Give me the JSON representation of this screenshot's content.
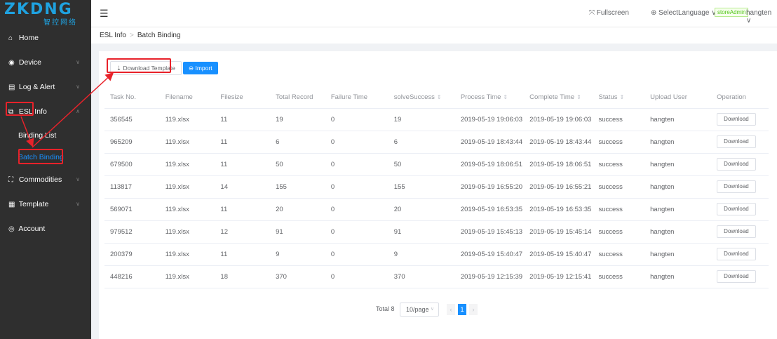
{
  "logo": {
    "main": "ZKDNG",
    "sub": "智控网络"
  },
  "sidebar": {
    "items": [
      {
        "label": "Home",
        "icon": "home-icon",
        "glyph": "⌂"
      },
      {
        "label": "Device",
        "icon": "device-icon",
        "glyph": "◉"
      },
      {
        "label": "Log & Alert",
        "icon": "log-icon",
        "glyph": "▤"
      },
      {
        "label": "ESL Info",
        "icon": "tag-icon",
        "glyph": "⧉"
      },
      {
        "label": "Commodities",
        "icon": "commodities-icon",
        "glyph": "⛶"
      },
      {
        "label": "Template",
        "icon": "template-icon",
        "glyph": "▦"
      },
      {
        "label": "Account",
        "icon": "account-icon",
        "glyph": "◎"
      }
    ],
    "sub_items": [
      {
        "label": "Binding List"
      },
      {
        "label": "Batch Binding"
      }
    ]
  },
  "header": {
    "menu_glyph": "☰",
    "fullscreen": "⤧ Fullscreen",
    "language": "⊕ SelectLanguage ∨",
    "badge": "storeAdmin",
    "user": "hangten ∨"
  },
  "breadcrumb": {
    "first": "ESL Info",
    "sep": ">",
    "current": "Batch Binding"
  },
  "toolbar": {
    "download_template": "⇣ Download Template",
    "import": "⊖ Import"
  },
  "table": {
    "columns": [
      "Task No.",
      "Filename",
      "Filesize",
      "Total Record",
      "Failure Time",
      "solveSuccess",
      "Process Time",
      "Complete Time",
      "Status",
      "Upload User",
      "Operation"
    ],
    "sortable": [
      false,
      false,
      false,
      false,
      false,
      true,
      true,
      true,
      true,
      false,
      false
    ],
    "rows": [
      [
        "356545",
        "119.xlsx",
        "11",
        "19",
        "0",
        "19",
        "2019-05-19 19:06:03",
        "2019-05-19 19:06:03",
        "success",
        "hangten"
      ],
      [
        "965209",
        "119.xlsx",
        "11",
        "6",
        "0",
        "6",
        "2019-05-19 18:43:44",
        "2019-05-19 18:43:44",
        "success",
        "hangten"
      ],
      [
        "679500",
        "119.xlsx",
        "11",
        "50",
        "0",
        "50",
        "2019-05-19 18:06:51",
        "2019-05-19 18:06:51",
        "success",
        "hangten"
      ],
      [
        "113817",
        "119.xlsx",
        "14",
        "155",
        "0",
        "155",
        "2019-05-19 16:55:20",
        "2019-05-19 16:55:21",
        "success",
        "hangten"
      ],
      [
        "569071",
        "119.xlsx",
        "11",
        "20",
        "0",
        "20",
        "2019-05-19 16:53:35",
        "2019-05-19 16:53:35",
        "success",
        "hangten"
      ],
      [
        "979512",
        "119.xlsx",
        "12",
        "91",
        "0",
        "91",
        "2019-05-19 15:45:13",
        "2019-05-19 15:45:14",
        "success",
        "hangten"
      ],
      [
        "200379",
        "119.xlsx",
        "11",
        "9",
        "0",
        "9",
        "2019-05-19 15:40:47",
        "2019-05-19 15:40:47",
        "success",
        "hangten"
      ],
      [
        "448216",
        "119.xlsx",
        "18",
        "370",
        "0",
        "370",
        "2019-05-19 12:15:39",
        "2019-05-19 12:15:41",
        "success",
        "hangten"
      ]
    ],
    "row_action": "Download",
    "sort_glyph": "⇕"
  },
  "pagination": {
    "total": "Total 8",
    "page_size": "10/page",
    "current_page": "1",
    "prev_glyph": "‹",
    "next_glyph": "›",
    "dropdown_glyph": "∨"
  },
  "colors": {
    "sidebar_bg": "#2f2f2f",
    "accent": "#1890ff",
    "annotation_red": "#e8222a"
  }
}
